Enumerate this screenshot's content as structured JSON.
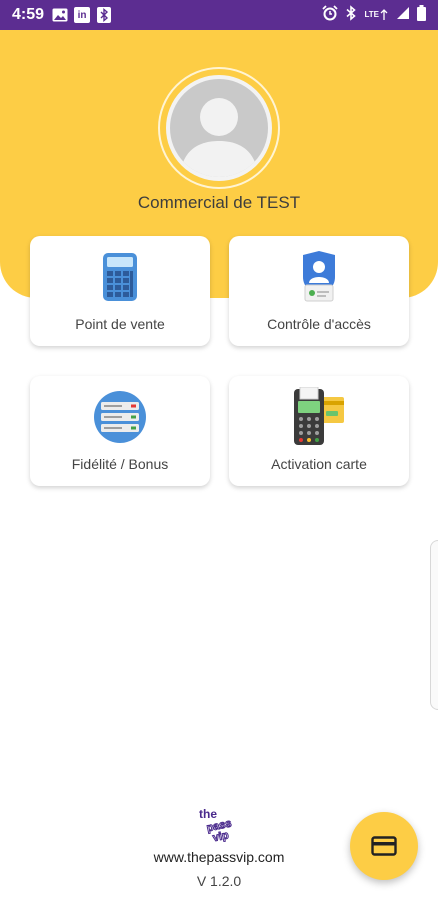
{
  "status_bar": {
    "time": "4:59",
    "linkedin_label": "in",
    "lte_label": "LTE"
  },
  "profile": {
    "name": "Commercial de TEST"
  },
  "tiles": [
    {
      "label": "Point de vente",
      "icon": "calculator-icon"
    },
    {
      "label": "Contrôle d'accès",
      "icon": "access-badge-icon"
    },
    {
      "label": "Fidélité / Bonus",
      "icon": "server-icon"
    },
    {
      "label": "Activation carte",
      "icon": "payment-terminal-icon"
    }
  ],
  "footer": {
    "logo_text": [
      "the",
      "pass",
      "vip"
    ],
    "website": "www.thepassvip.com",
    "version": "V 1.2.0"
  },
  "fab": {
    "icon": "credit-card-icon"
  },
  "colors": {
    "status_bar": "#5c2d91",
    "header": "#fdcd45",
    "logo": "#4a2a8c"
  }
}
